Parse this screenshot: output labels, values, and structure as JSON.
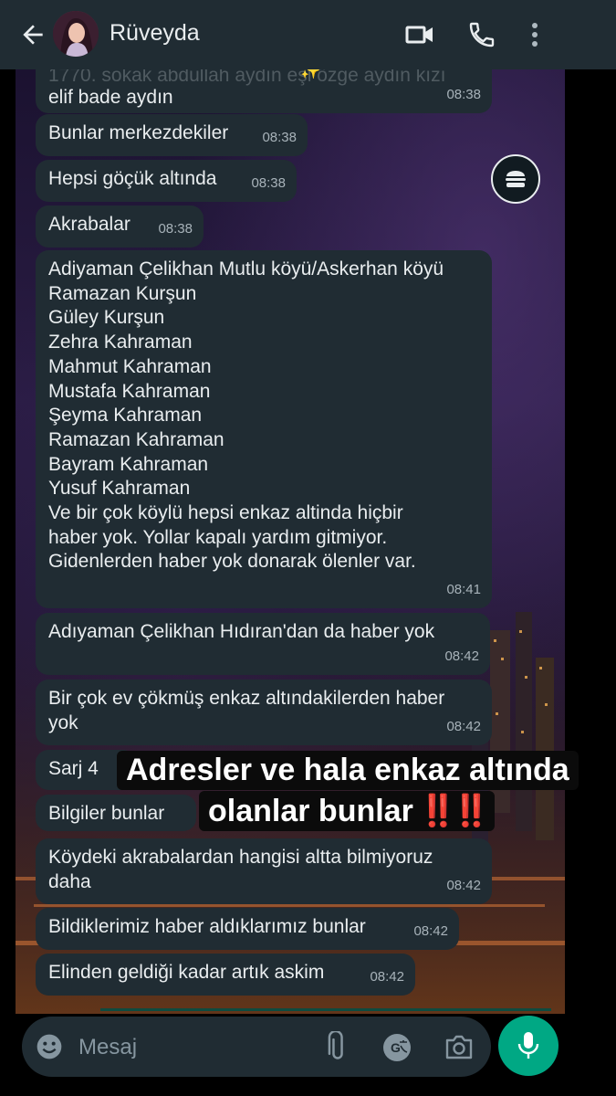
{
  "header": {
    "contact_name": "Rüveyda",
    "icons": [
      "back-arrow-icon",
      "avatar",
      "video-call-icon",
      "phone-icon",
      "more-vert-icon"
    ]
  },
  "messages": [
    {
      "text": "elif bade aydın",
      "time": "08:38",
      "partial_top": "1770. sokak abdullah aydın eşi özge aydın kızı"
    },
    {
      "text": "Bunlar merkezdekiler",
      "time": "08:38"
    },
    {
      "text": "Hepsi göçük altında",
      "time": "08:38"
    },
    {
      "text": "Akrabalar",
      "time": "08:38"
    },
    {
      "text": "Adiyaman Çelikhan Mutlu köyü/Askerhan köyü\nRamazan Kurşun\nGüley Kurşun\nZehra Kahraman\nMahmut Kahraman\nMustafa Kahraman\nŞeyma Kahraman\nRamazan Kahraman\nBayram Kahraman\nYusuf Kahraman\nVe bir çok köylü hepsi enkaz altinda hiçbir\nhaber yok. Yollar kapalı yardım gitmiyor.\nGidenlerden haber yok donarak ölenler var.",
      "time": "08:41"
    },
    {
      "text": "Adıyaman Çelikhan Hıdıran'dan da haber yok",
      "time": "08:42"
    },
    {
      "text": "Bir çok ev çökmüş enkaz altındakilerden haber\nyok",
      "time": "08:42"
    },
    {
      "text": "Sarj 4",
      "time": ""
    },
    {
      "text": "Bilgiler bunlar",
      "time": ""
    },
    {
      "text": "Köydeki akrabalardan hangisi altta bilmiyoruz\ndaha",
      "time": "08:42"
    },
    {
      "text": "Bildiklerimiz haber aldıklarımız bunlar",
      "time": "08:42"
    },
    {
      "text": "Elinden geldiği kadar artık askim",
      "time": "08:42"
    }
  ],
  "overlay": {
    "line1": "Adresler ve hala enkaz altında",
    "line2": "olanlar bunlar",
    "emoji": "‼️‼️"
  },
  "input": {
    "placeholder": "Mesaj",
    "value": ""
  },
  "colors": {
    "bubble": "#202c33",
    "header": "#202c33",
    "accent": "#00a884",
    "text": "#e9edef",
    "timestamp": "#a8b3ba"
  }
}
